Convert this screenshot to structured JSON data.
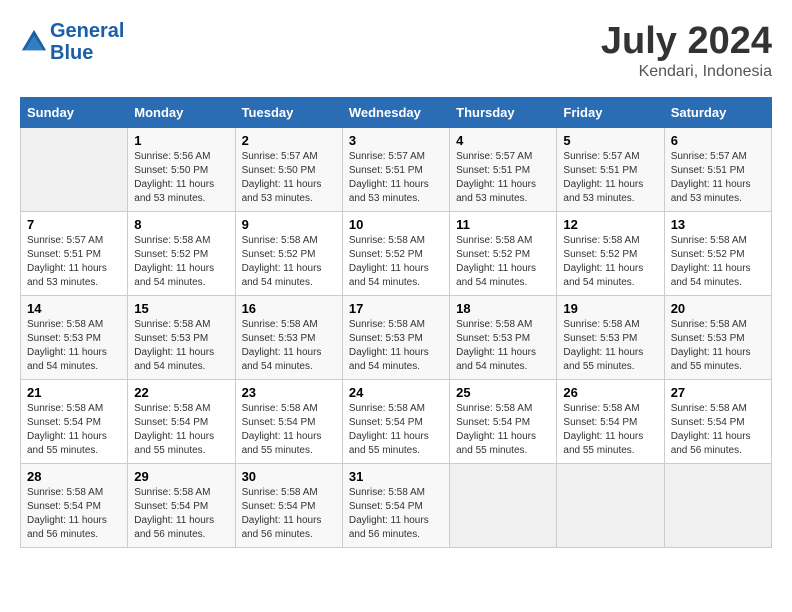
{
  "header": {
    "logo_line1": "General",
    "logo_line2": "Blue",
    "title": "July 2024",
    "subtitle": "Kendari, Indonesia"
  },
  "calendar": {
    "weekdays": [
      "Sunday",
      "Monday",
      "Tuesday",
      "Wednesday",
      "Thursday",
      "Friday",
      "Saturday"
    ],
    "weeks": [
      [
        {
          "day": "",
          "info": ""
        },
        {
          "day": "1",
          "info": "Sunrise: 5:56 AM\nSunset: 5:50 PM\nDaylight: 11 hours\nand 53 minutes."
        },
        {
          "day": "2",
          "info": "Sunrise: 5:57 AM\nSunset: 5:50 PM\nDaylight: 11 hours\nand 53 minutes."
        },
        {
          "day": "3",
          "info": "Sunrise: 5:57 AM\nSunset: 5:51 PM\nDaylight: 11 hours\nand 53 minutes."
        },
        {
          "day": "4",
          "info": "Sunrise: 5:57 AM\nSunset: 5:51 PM\nDaylight: 11 hours\nand 53 minutes."
        },
        {
          "day": "5",
          "info": "Sunrise: 5:57 AM\nSunset: 5:51 PM\nDaylight: 11 hours\nand 53 minutes."
        },
        {
          "day": "6",
          "info": "Sunrise: 5:57 AM\nSunset: 5:51 PM\nDaylight: 11 hours\nand 53 minutes."
        }
      ],
      [
        {
          "day": "7",
          "info": "Sunrise: 5:57 AM\nSunset: 5:51 PM\nDaylight: 11 hours\nand 53 minutes."
        },
        {
          "day": "8",
          "info": "Sunrise: 5:58 AM\nSunset: 5:52 PM\nDaylight: 11 hours\nand 54 minutes."
        },
        {
          "day": "9",
          "info": "Sunrise: 5:58 AM\nSunset: 5:52 PM\nDaylight: 11 hours\nand 54 minutes."
        },
        {
          "day": "10",
          "info": "Sunrise: 5:58 AM\nSunset: 5:52 PM\nDaylight: 11 hours\nand 54 minutes."
        },
        {
          "day": "11",
          "info": "Sunrise: 5:58 AM\nSunset: 5:52 PM\nDaylight: 11 hours\nand 54 minutes."
        },
        {
          "day": "12",
          "info": "Sunrise: 5:58 AM\nSunset: 5:52 PM\nDaylight: 11 hours\nand 54 minutes."
        },
        {
          "day": "13",
          "info": "Sunrise: 5:58 AM\nSunset: 5:52 PM\nDaylight: 11 hours\nand 54 minutes."
        }
      ],
      [
        {
          "day": "14",
          "info": "Sunrise: 5:58 AM\nSunset: 5:53 PM\nDaylight: 11 hours\nand 54 minutes."
        },
        {
          "day": "15",
          "info": "Sunrise: 5:58 AM\nSunset: 5:53 PM\nDaylight: 11 hours\nand 54 minutes."
        },
        {
          "day": "16",
          "info": "Sunrise: 5:58 AM\nSunset: 5:53 PM\nDaylight: 11 hours\nand 54 minutes."
        },
        {
          "day": "17",
          "info": "Sunrise: 5:58 AM\nSunset: 5:53 PM\nDaylight: 11 hours\nand 54 minutes."
        },
        {
          "day": "18",
          "info": "Sunrise: 5:58 AM\nSunset: 5:53 PM\nDaylight: 11 hours\nand 54 minutes."
        },
        {
          "day": "19",
          "info": "Sunrise: 5:58 AM\nSunset: 5:53 PM\nDaylight: 11 hours\nand 55 minutes."
        },
        {
          "day": "20",
          "info": "Sunrise: 5:58 AM\nSunset: 5:53 PM\nDaylight: 11 hours\nand 55 minutes."
        }
      ],
      [
        {
          "day": "21",
          "info": "Sunrise: 5:58 AM\nSunset: 5:54 PM\nDaylight: 11 hours\nand 55 minutes."
        },
        {
          "day": "22",
          "info": "Sunrise: 5:58 AM\nSunset: 5:54 PM\nDaylight: 11 hours\nand 55 minutes."
        },
        {
          "day": "23",
          "info": "Sunrise: 5:58 AM\nSunset: 5:54 PM\nDaylight: 11 hours\nand 55 minutes."
        },
        {
          "day": "24",
          "info": "Sunrise: 5:58 AM\nSunset: 5:54 PM\nDaylight: 11 hours\nand 55 minutes."
        },
        {
          "day": "25",
          "info": "Sunrise: 5:58 AM\nSunset: 5:54 PM\nDaylight: 11 hours\nand 55 minutes."
        },
        {
          "day": "26",
          "info": "Sunrise: 5:58 AM\nSunset: 5:54 PM\nDaylight: 11 hours\nand 55 minutes."
        },
        {
          "day": "27",
          "info": "Sunrise: 5:58 AM\nSunset: 5:54 PM\nDaylight: 11 hours\nand 56 minutes."
        }
      ],
      [
        {
          "day": "28",
          "info": "Sunrise: 5:58 AM\nSunset: 5:54 PM\nDaylight: 11 hours\nand 56 minutes."
        },
        {
          "day": "29",
          "info": "Sunrise: 5:58 AM\nSunset: 5:54 PM\nDaylight: 11 hours\nand 56 minutes."
        },
        {
          "day": "30",
          "info": "Sunrise: 5:58 AM\nSunset: 5:54 PM\nDaylight: 11 hours\nand 56 minutes."
        },
        {
          "day": "31",
          "info": "Sunrise: 5:58 AM\nSunset: 5:54 PM\nDaylight: 11 hours\nand 56 minutes."
        },
        {
          "day": "",
          "info": ""
        },
        {
          "day": "",
          "info": ""
        },
        {
          "day": "",
          "info": ""
        }
      ]
    ]
  }
}
